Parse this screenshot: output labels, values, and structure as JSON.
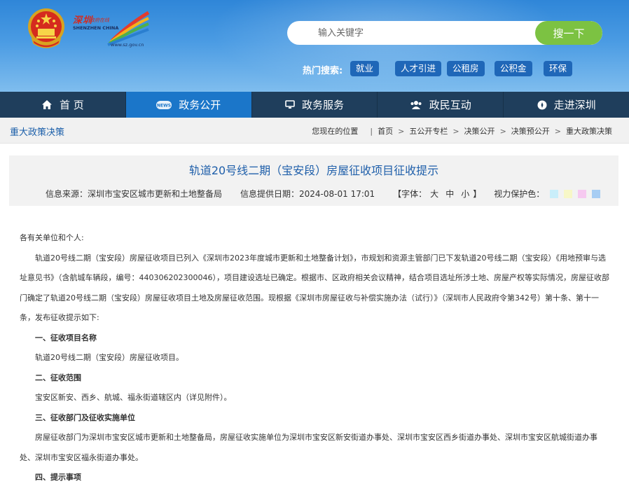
{
  "logo": {
    "cn_title": "深圳",
    "cn_small": "政府在线",
    "en": "SHENZHEN CHINA",
    "url": "www.sz.gov.cn"
  },
  "search": {
    "placeholder": "输入关键字",
    "button_label": "搜一下"
  },
  "hot_search": {
    "label": "热门搜索:",
    "tags": [
      "就业",
      "人才引进",
      "公租房",
      "公积金",
      "环保"
    ]
  },
  "nav": {
    "items": [
      {
        "label": "首 页",
        "icon": "home-icon"
      },
      {
        "label": "政务公开",
        "icon": "news-icon"
      },
      {
        "label": "政务服务",
        "icon": "monitor-icon"
      },
      {
        "label": "政民互动",
        "icon": "people-icon"
      },
      {
        "label": "走进深圳",
        "icon": "compass-icon"
      }
    ],
    "active_index": 1
  },
  "breadcrumb": {
    "section_title": "重大政策决策",
    "lead": "您现在的位置",
    "items": [
      "首页",
      "五公开专栏",
      "决策公开",
      "决策预公开",
      "重大政策决策"
    ]
  },
  "article": {
    "title": "轨道20号线二期（宝安段）房屋征收项目征收提示",
    "source": "信息来源：深圳市宝安区城市更新和土地整备局",
    "date": "信息提供日期：2024-08-01 17:01",
    "font_label": "【字体：",
    "font_sizes": [
      "大",
      "中",
      "小"
    ],
    "font_close": "】",
    "eye_label": "视力保护色：",
    "eye_colors": [
      "#c9eefa",
      "#f7f7c7",
      "#f6c9f0",
      "#a7cdf3"
    ],
    "paragraphs": [
      "各有关单位和个人:",
      "轨道20号线二期（宝安段）房屋征收项目已列入《深圳市2023年度城市更新和土地整备计划》，市规划和资源主管部门已下发轨道20号线二期（宝安段）《用地预审与选址意见书》（含航城车辆段，编号：440306202300046），项目建设选址已确定。根据市、区政府相关会议精神，结合项目选址所涉土地、房屋产权等实际情况，房屋征收部门确定了轨道20号线二期（宝安段）房屋征收项目土地及房屋征收范围。现根据《深圳市房屋征收与补偿实施办法（试行）》（深圳市人民政府令第342号）第十条、第十一条，发布征收提示如下:",
      "一、征收项目名称",
      "轨道20号线二期（宝安段）房屋征收项目。",
      "二、征收范围",
      "宝安区新安、西乡、航城、福永街道辖区内（详见附件）。",
      "三、征收部门及征收实施单位",
      "房屋征收部门为深圳市宝安区城市更新和土地整备局，房屋征收实施单位为深圳市宝安区新安街道办事处、深圳市宝安区西乡街道办事处、深圳市宝安区航城街道办事处、深圳市宝安区福永街道办事处。",
      "四、提示事项"
    ]
  }
}
